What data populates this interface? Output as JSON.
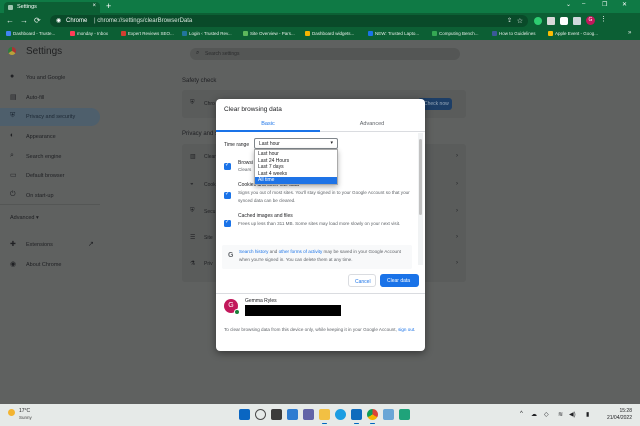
{
  "browser": {
    "tab_title": "Settings",
    "tab_close": "×",
    "new_tab": "+",
    "window_controls": [
      "⌄",
      "–",
      "❐",
      "✕"
    ],
    "nav": [
      "←",
      "→",
      "⟳"
    ],
    "omnibox_host": "Chrome",
    "omnibox_separator": "|",
    "omnibox_path": "chrome://settings/clearBrowserData",
    "avatar_initial": "G",
    "menu_glyph": "⋮",
    "bookmarks": [
      {
        "label": "Dashboard - Truste...",
        "color": "#4285f4"
      },
      {
        "label": "monday - Inbox",
        "color": "#ff3d57"
      },
      {
        "label": "Expert Reviews SEO...",
        "color": "#d23f31"
      },
      {
        "label": "Login ‹ Trusted Rev...",
        "color": "#21759b"
      },
      {
        "label": "Site Overview - Pars...",
        "color": "#5cb85c"
      },
      {
        "label": "Dashboard widgets...",
        "color": "#f4b400"
      },
      {
        "label": "NEW: Trusted Lapto...",
        "color": "#1a73e8"
      },
      {
        "label": "Computing Bench...",
        "color": "#34a853"
      },
      {
        "label": "How to Guidelines",
        "color": "#3b5998"
      },
      {
        "label": "Apple Event - Goog...",
        "color": "#fbbc04"
      }
    ],
    "bookmarks_more": "»"
  },
  "settings": {
    "title": "Settings",
    "search_placeholder": "Search settings",
    "sidebar": [
      {
        "label": "You and Google",
        "icon": "person-icon",
        "glyph": "●"
      },
      {
        "label": "Auto-fill",
        "icon": "autofill-icon",
        "glyph": "▤"
      },
      {
        "label": "Privacy and security",
        "icon": "shield-icon",
        "glyph": "⛨"
      },
      {
        "label": "Appearance",
        "icon": "palette-icon",
        "glyph": "◐"
      },
      {
        "label": "Search engine",
        "icon": "search-icon",
        "glyph": "⌕"
      },
      {
        "label": "Default browser",
        "icon": "browser-icon",
        "glyph": "▭"
      },
      {
        "label": "On start-up",
        "icon": "power-icon",
        "glyph": "⏻"
      }
    ],
    "advanced_label": "Advanced",
    "advanced_caret": "▾",
    "extensions_label": "Extensions",
    "extensions_link_glyph": "↗",
    "about_label": "About Chrome",
    "safety_check_title": "Safety check",
    "safety_row_prefix": "Chro",
    "safety_button": "Check now",
    "privacy_section_title": "Privacy and s",
    "rows": [
      "Clear",
      "Cook",
      "Secu",
      "Site",
      "Priv"
    ],
    "row_arrow": "›"
  },
  "dialog": {
    "title": "Clear browsing data",
    "tabs": [
      "Basic",
      "Advanced"
    ],
    "time_range_label": "Time range",
    "time_range_value": "Last hour",
    "time_range_options": [
      "Last hour",
      "Last 24 Hours",
      "Last 7 days",
      "Last 4 weeks",
      "All time"
    ],
    "highlighted_option": "All time",
    "caret": "▾",
    "checkbox_tick": "✓",
    "history_partial_title": "Browsi",
    "history_partial_desc": "Clears",
    "cookies_title": "Cookies and other site data",
    "cookies_desc": "Signs you out of most sites. You'll stay signed in to your Google Account so that your synced data can be cleared.",
    "cache_title": "Cached images and files",
    "cache_desc": "Frees up less than 311 MB. Some sites may load more slowly on your next visit.",
    "g_logo": "G",
    "info_link_1": "Search history",
    "info_and": " and ",
    "info_link_2": "other forms of activity",
    "info_rest": " may be saved in your Google Account when you're signed in. You can delete them at any time.",
    "cancel_label": "Cancel",
    "clear_label": "Clear data",
    "account_name": "Gemma Ryles",
    "account_initial": "G",
    "footer_text": "To clear browsing data from this device only, while keeping it in your Google Account, ",
    "footer_link": "sign out",
    "footer_end": "."
  },
  "taskbar": {
    "temperature": "17°C",
    "condition": "Sunny",
    "apps": [
      {
        "name": "start-icon",
        "color": "#0a66c2"
      },
      {
        "name": "search-icon",
        "color": "#4a4a4a"
      },
      {
        "name": "task-view-icon",
        "color": "#3b3b3b"
      },
      {
        "name": "widgets-icon",
        "color": "#2f7dd1"
      },
      {
        "name": "chat-icon",
        "color": "#6264a7"
      },
      {
        "name": "file-explorer-icon",
        "color": "#f2c043"
      },
      {
        "name": "edge-icon",
        "color": "#1b9de2"
      },
      {
        "name": "outlook-icon",
        "color": "#0f6cbd"
      },
      {
        "name": "store-icon",
        "color": "#2d7dd2"
      },
      {
        "name": "chrome-icon",
        "color": "#db4437"
      },
      {
        "name": "notepad-icon",
        "color": "#6aa6d6"
      },
      {
        "name": "terminal-icon",
        "color": "#1fa37a"
      }
    ],
    "tray_glyphs": [
      "^",
      "☁",
      "◇",
      "≋",
      "◀)",
      "▮"
    ],
    "time": "15:28",
    "date": "21/04/2022"
  }
}
